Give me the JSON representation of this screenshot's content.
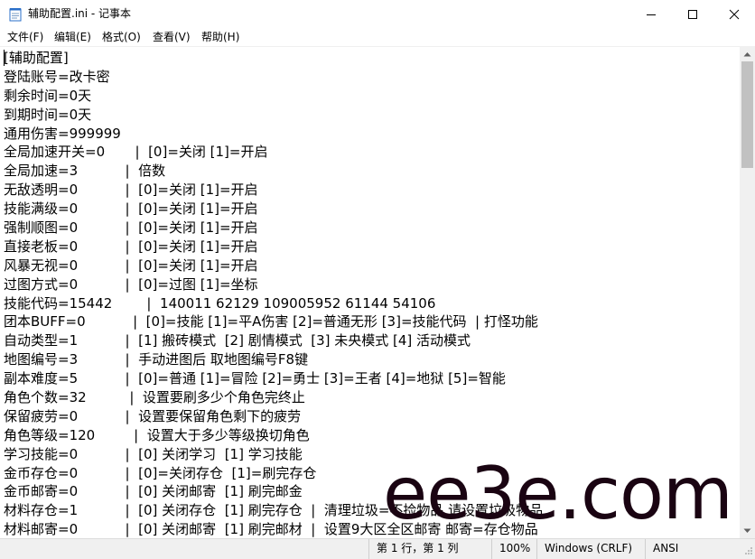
{
  "window": {
    "title": "辅助配置.ini - 记事本"
  },
  "menu": [
    {
      "label": "文件(F)"
    },
    {
      "label": "编辑(E)"
    },
    {
      "label": "格式(O)"
    },
    {
      "label": "查看(V)"
    },
    {
      "label": "帮助(H)"
    }
  ],
  "editor": {
    "lines": [
      "[辅助配置]",
      "登陆账号=改卡密",
      "剩余时间=0天",
      "到期时间=0天",
      "通用伤害=999999",
      "全局加速开关=0       |  [0]=关闭 [1]=开启",
      "全局加速=3           |  倍数",
      "无敌透明=0           |  [0]=关闭 [1]=开启",
      "技能满级=0           |  [0]=关闭 [1]=开启",
      "强制顺图=0           |  [0]=关闭 [1]=开启",
      "直接老板=0           |  [0]=关闭 [1]=开启",
      "风暴无视=0           |  [0]=关闭 [1]=开启",
      "过图方式=0           |  [0]=过图 [1]=坐标",
      "技能代码=15442        |  140011 62129 109005952 61144 54106",
      "团本BUFF=0           |  [0]=技能 [1]=平A伤害 [2]=普通无形 [3]=技能代码  | 打怪功能",
      "自动类型=1           |  [1] 搬砖模式  [2] 剧情模式  [3] 未央模式 [4] 活动模式",
      "地图编号=3           |  手动进图后 取地图编号F8键",
      "副本难度=5           |  [0]=普通 [1]=冒险 [2]=勇士 [3]=王者 [4]=地狱 [5]=智能",
      "角色个数=32          |  设置要刷多少个角色完终止",
      "保留疲劳=0           |  设置要保留角色剩下的疲劳",
      "角色等级=120         |  设置大于多少等级换切角色",
      "学习技能=0           |  [0] 关闭学习  [1] 学习技能",
      "金币存仓=0           |  [0]=关闭存仓  [1]=刷完存仓",
      "金币邮寄=0           |  [0] 关闭邮寄  [1] 刷完邮金",
      "材料存仓=1           |  [0] 关闭存仓  [1] 刷完存仓  |  清理垃圾=不捡物品 请设置垃圾物品",
      "材料邮寄=0           |  [0] 关闭邮寄  [1] 刷完邮材  |  设置9大区全区邮寄 邮寄=存仓物品"
    ]
  },
  "status": {
    "position": "第 1 行，第 1 列",
    "zoom": "100%",
    "line_ending": "Windows (CRLF)",
    "encoding": "ANSI"
  },
  "watermark": "ee3e.com",
  "icons": {
    "app": "notepad-icon",
    "minimize": "minimize-icon",
    "maximize": "maximize-icon",
    "close": "close-icon",
    "scroll_up": "chevron-up-icon",
    "scroll_down": "chevron-down-icon"
  }
}
